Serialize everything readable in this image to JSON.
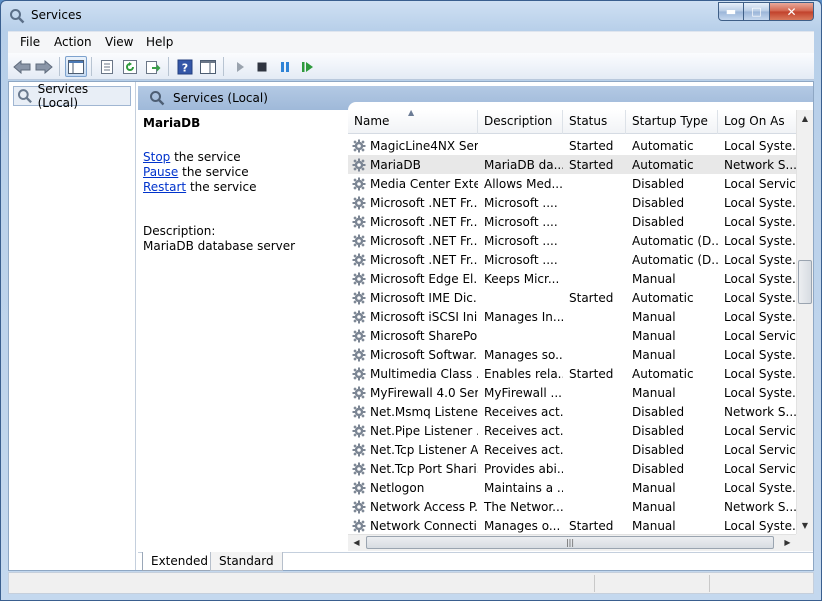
{
  "window": {
    "title": "Services"
  },
  "menu": [
    "File",
    "Action",
    "View",
    "Help"
  ],
  "tree": {
    "root_label": "Services (Local)"
  },
  "main": {
    "header_label": "Services (Local)"
  },
  "detail": {
    "service_name": "MariaDB",
    "actions": [
      {
        "link": "Stop",
        "rest": " the service"
      },
      {
        "link": "Pause",
        "rest": " the service"
      },
      {
        "link": "Restart",
        "rest": " the service"
      }
    ],
    "description_label": "Description:",
    "description_text": "MariaDB database server"
  },
  "list": {
    "columns": [
      "Name",
      "Description",
      "Status",
      "Startup Type",
      "Log On As"
    ],
    "rows": [
      {
        "name": "MagicLine4NX Ser...",
        "description": "",
        "status": "Started",
        "startup": "Automatic",
        "logon": "Local Syste..."
      },
      {
        "name": "MariaDB",
        "description": "MariaDB da...",
        "status": "Started",
        "startup": "Automatic",
        "logon": "Network S...",
        "selected": true
      },
      {
        "name": "Media Center Exte...",
        "description": "Allows Med...",
        "status": "",
        "startup": "Disabled",
        "logon": "Local Service"
      },
      {
        "name": "Microsoft .NET Fr...",
        "description": "Microsoft ....",
        "status": "",
        "startup": "Disabled",
        "logon": "Local Syste..."
      },
      {
        "name": "Microsoft .NET Fr...",
        "description": "Microsoft ....",
        "status": "",
        "startup": "Disabled",
        "logon": "Local Syste..."
      },
      {
        "name": "Microsoft .NET Fr...",
        "description": "Microsoft ....",
        "status": "",
        "startup": "Automatic (D...",
        "logon": "Local Syste..."
      },
      {
        "name": "Microsoft .NET Fr...",
        "description": "Microsoft ....",
        "status": "",
        "startup": "Automatic (D...",
        "logon": "Local Syste..."
      },
      {
        "name": "Microsoft Edge El...",
        "description": "Keeps Micr...",
        "status": "",
        "startup": "Manual",
        "logon": "Local Syste..."
      },
      {
        "name": "Microsoft IME Dic...",
        "description": "",
        "status": "Started",
        "startup": "Automatic",
        "logon": "Local Syste..."
      },
      {
        "name": "Microsoft iSCSI Ini...",
        "description": "Manages In...",
        "status": "",
        "startup": "Manual",
        "logon": "Local Syste..."
      },
      {
        "name": "Microsoft SharePo...",
        "description": "",
        "status": "",
        "startup": "Manual",
        "logon": "Local Service"
      },
      {
        "name": "Microsoft Softwar...",
        "description": "Manages so...",
        "status": "",
        "startup": "Manual",
        "logon": "Local Syste..."
      },
      {
        "name": "Multimedia Class ...",
        "description": "Enables rela...",
        "status": "Started",
        "startup": "Automatic",
        "logon": "Local Syste..."
      },
      {
        "name": "MyFirewall 4.0 Ser...",
        "description": "MyFirewall ...",
        "status": "",
        "startup": "Manual",
        "logon": "Local Syste..."
      },
      {
        "name": "Net.Msmq Listene...",
        "description": "Receives act...",
        "status": "",
        "startup": "Disabled",
        "logon": "Network S..."
      },
      {
        "name": "Net.Pipe Listener ...",
        "description": "Receives act...",
        "status": "",
        "startup": "Disabled",
        "logon": "Local Service"
      },
      {
        "name": "Net.Tcp Listener A...",
        "description": "Receives act...",
        "status": "",
        "startup": "Disabled",
        "logon": "Local Service"
      },
      {
        "name": "Net.Tcp Port Shari...",
        "description": "Provides abi...",
        "status": "",
        "startup": "Disabled",
        "logon": "Local Service"
      },
      {
        "name": "Netlogon",
        "description": "Maintains a ...",
        "status": "",
        "startup": "Manual",
        "logon": "Local Syste..."
      },
      {
        "name": "Network Access P...",
        "description": "The Networ...",
        "status": "",
        "startup": "Manual",
        "logon": "Network S..."
      },
      {
        "name": "Network Connecti...",
        "description": "Manages o...",
        "status": "Started",
        "startup": "Manual",
        "logon": "Local Syste..."
      }
    ]
  },
  "tabs": [
    "Extended",
    "Standard"
  ],
  "colors": {
    "selected_row": "#e8e8e8",
    "link": "#0033cc",
    "header_band": "#a9c2e0"
  }
}
